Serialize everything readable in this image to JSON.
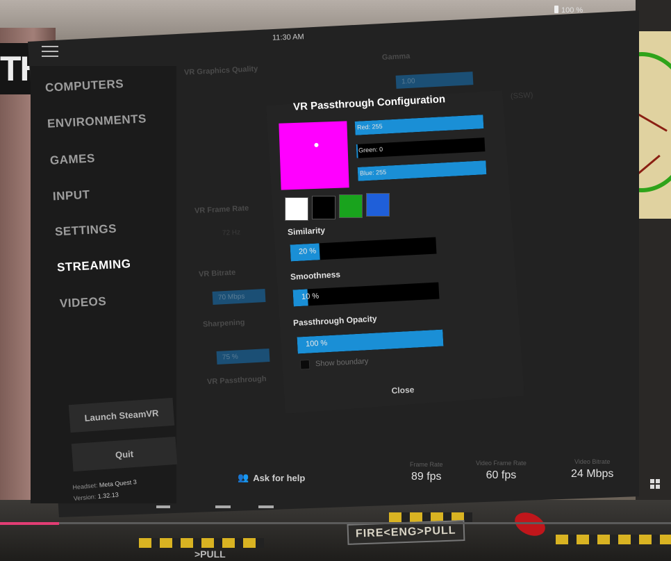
{
  "status": {
    "time": "11:30 AM",
    "battery": "100 %"
  },
  "logo": {
    "text": "TH"
  },
  "sidebar": {
    "items": [
      {
        "label": "COMPUTERS",
        "active": false
      },
      {
        "label": "ENVIRONMENTS",
        "active": false
      },
      {
        "label": "GAMES",
        "active": false
      },
      {
        "label": "INPUT",
        "active": false
      },
      {
        "label": "SETTINGS",
        "active": false
      },
      {
        "label": "STREAMING",
        "active": true
      },
      {
        "label": "VIDEOS",
        "active": false
      }
    ],
    "launch_label": "Launch SteamVR",
    "quit_label": "Quit",
    "headset_label": "Headset:",
    "headset_value": "Meta Quest 3",
    "version_label": "Version:",
    "version_value": "1.32.13"
  },
  "background_settings": {
    "graphics_quality": "VR Graphics Quality",
    "gamma": "Gamma",
    "gamma_value": "1.00",
    "frame_rate": "VR Frame Rate",
    "frame_rate_value": "72 Hz",
    "bitrate": "VR Bitrate",
    "bitrate_value": "70 Mbps",
    "sharpening": "Sharpening",
    "sharpening_value": "75 %",
    "passthrough": "VR Passthrough",
    "ssw": "(SSW)"
  },
  "dialog": {
    "title": "VR Passthrough Configuration",
    "key_color": "#ff00ff",
    "red": {
      "label": "Red: 255",
      "value": 255
    },
    "green": {
      "label": "Green: 0",
      "value": 0
    },
    "blue": {
      "label": "Blue: 255",
      "value": 255
    },
    "presets": [
      "#ffffff",
      "#000000",
      "#19a31d",
      "#1f5fd9"
    ],
    "similarity": {
      "label": "Similarity",
      "text": "20 %",
      "value": 0.2
    },
    "smoothness": {
      "label": "Smoothness",
      "text": "10 %",
      "value": 0.1
    },
    "opacity": {
      "label": "Passthrough Opacity",
      "text": "100 %",
      "value": 1.0
    },
    "show_boundary": "Show boundary",
    "close_label": "Close"
  },
  "footer": {
    "ask_help": "Ask for help",
    "stats": [
      {
        "label": "Frame Rate",
        "value": "89 fps"
      },
      {
        "label": "Video Frame Rate",
        "value": "60 fps"
      },
      {
        "label": "Video Bitrate",
        "value": "24 Mbps"
      }
    ]
  },
  "cockpit": {
    "placard": "FIRE<ENG>PULL",
    "placard2": ">PULL"
  },
  "video": {
    "progress": 0.09
  }
}
